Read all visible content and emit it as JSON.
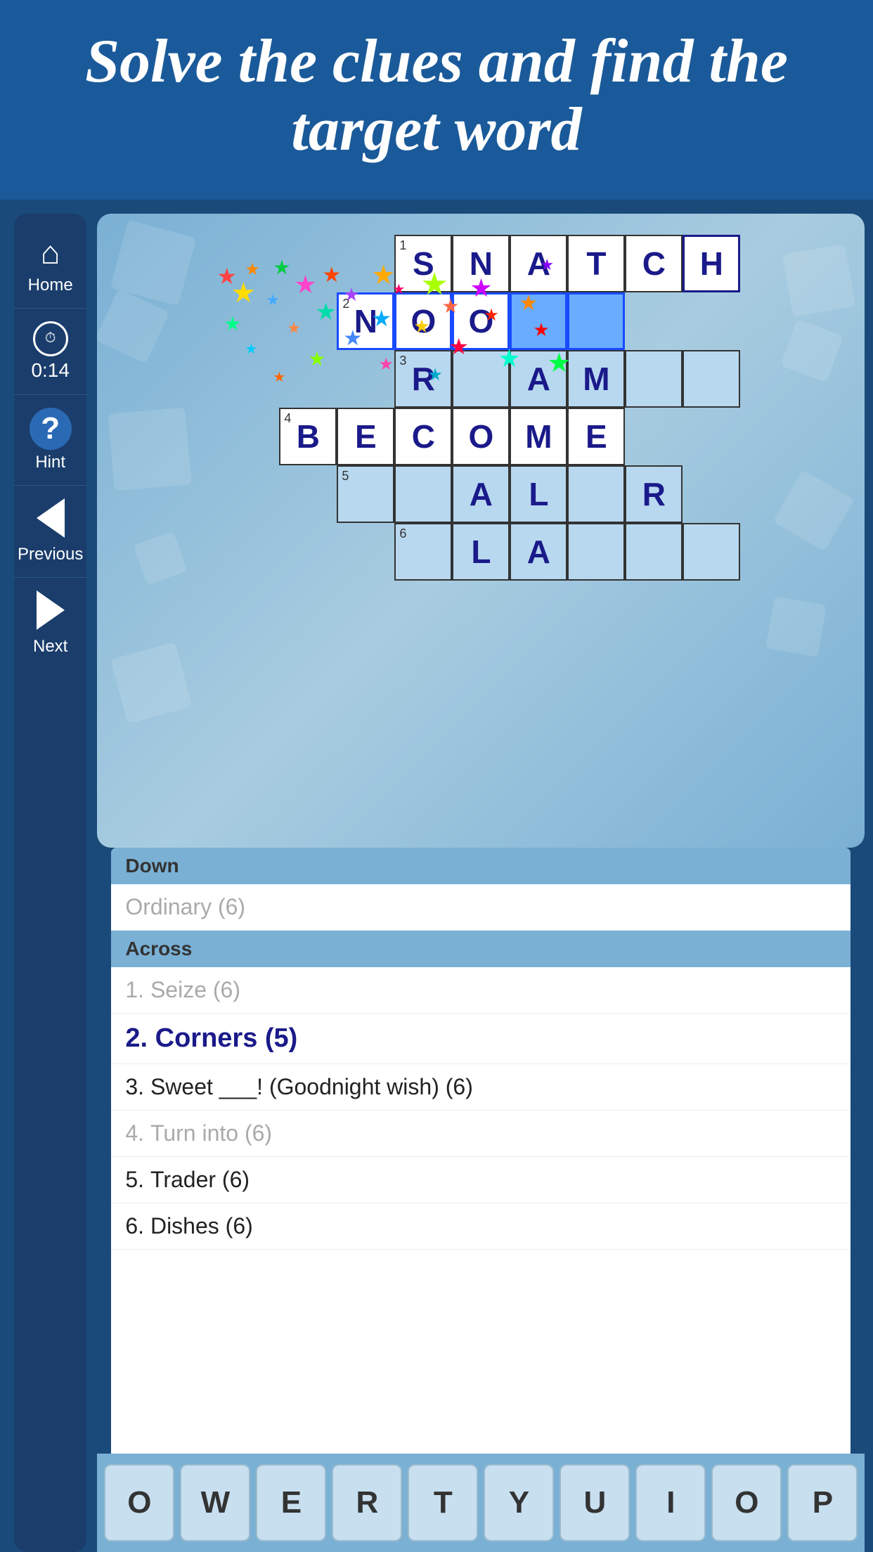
{
  "header": {
    "title": "Solve the clues and find the target word"
  },
  "sidebar": {
    "home_label": "Home",
    "timer_value": "0:14",
    "hint_label": "Hint",
    "previous_label": "Previous",
    "next_label": "Next"
  },
  "crossword": {
    "grid": [
      {
        "row": 1,
        "number": 1,
        "cells": [
          "S",
          "N",
          "A",
          "T",
          "C",
          "H"
        ],
        "col_start": 4
      },
      {
        "row": 2,
        "number": 2,
        "cells": [
          "N",
          "O",
          "O",
          "_",
          "_"
        ],
        "col_start": 3
      },
      {
        "row": 3,
        "number": 3,
        "cells": [
          "R",
          "_",
          "A",
          "M",
          "_",
          "_"
        ],
        "col_start": 4
      },
      {
        "row": 4,
        "number": 4,
        "cells": [
          "B",
          "E",
          "C",
          "O",
          "M",
          "E"
        ],
        "col_start": 2
      },
      {
        "row": 5,
        "number": 5,
        "cells": [
          "_",
          "_",
          "A",
          "L",
          "_",
          "R"
        ],
        "col_start": 3
      },
      {
        "row": 6,
        "number": 6,
        "cells": [
          "_",
          "L",
          "A",
          "_",
          "_",
          "_"
        ],
        "col_start": 4
      }
    ]
  },
  "clues": {
    "down_header": "Down",
    "down_clues": [
      {
        "text": "Ordinary (6)",
        "active": false,
        "completed": false
      }
    ],
    "across_header": "Across",
    "across_clues": [
      {
        "number": "1",
        "text": "Seize (6)",
        "active": false,
        "completed": true
      },
      {
        "number": "2",
        "text": "Corners (5)",
        "active": true,
        "completed": false
      },
      {
        "number": "3",
        "text": "Sweet ___! (Goodnight wish) (6)",
        "active": false,
        "completed": false
      },
      {
        "number": "4",
        "text": "Turn into (6)",
        "active": false,
        "completed": true
      },
      {
        "number": "5",
        "text": "Trader (6)",
        "active": false,
        "completed": false
      },
      {
        "number": "6",
        "text": "Dishes (6)",
        "active": false,
        "completed": false
      }
    ]
  },
  "keyboard": {
    "keys": [
      "O",
      "W",
      "E",
      "R",
      "T",
      "Y",
      "U",
      "I",
      "O",
      "P"
    ]
  }
}
